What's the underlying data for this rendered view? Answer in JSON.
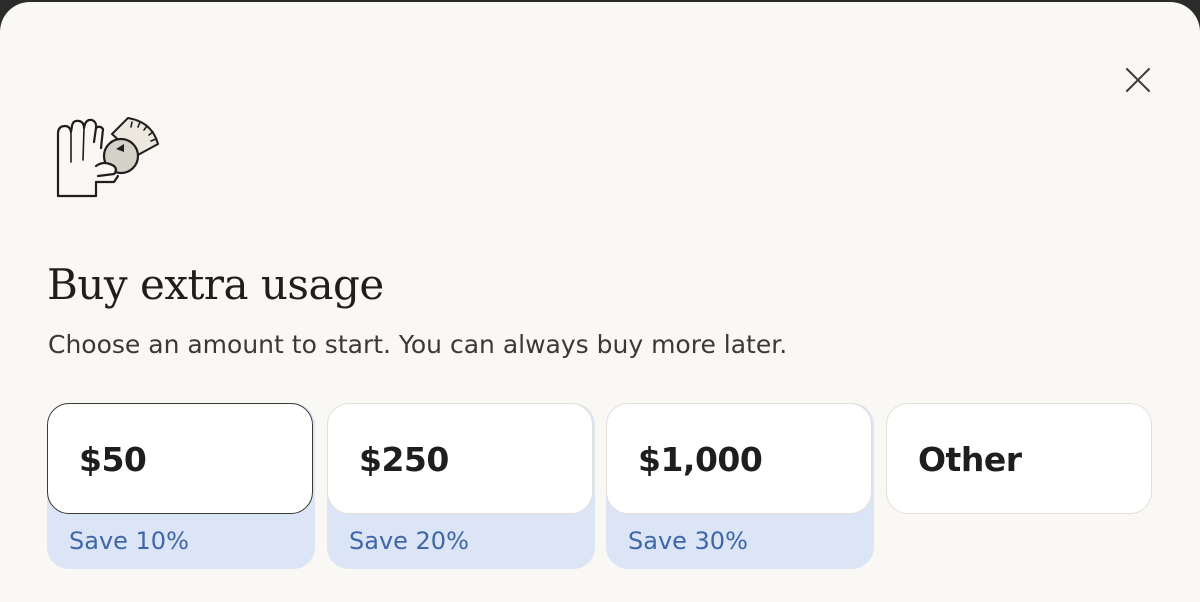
{
  "dialog": {
    "title": "Buy extra usage",
    "subtitle": "Choose an amount to start. You can always buy more later.",
    "close_icon": "close-icon",
    "hero_icon": "hand-with-dial-icon"
  },
  "options": [
    {
      "price": "$50",
      "save": "Save 10%",
      "selected": true
    },
    {
      "price": "$250",
      "save": "Save 20%",
      "selected": false
    },
    {
      "price": "$1,000",
      "save": "Save 30%",
      "selected": false
    },
    {
      "price": "Other",
      "save": null,
      "selected": false
    }
  ],
  "colors": {
    "background": "#faf8f4",
    "card": "#ffffff",
    "save_band": "#dbe5f5",
    "save_text": "#3f66a8",
    "text": "#1f1e1c"
  }
}
